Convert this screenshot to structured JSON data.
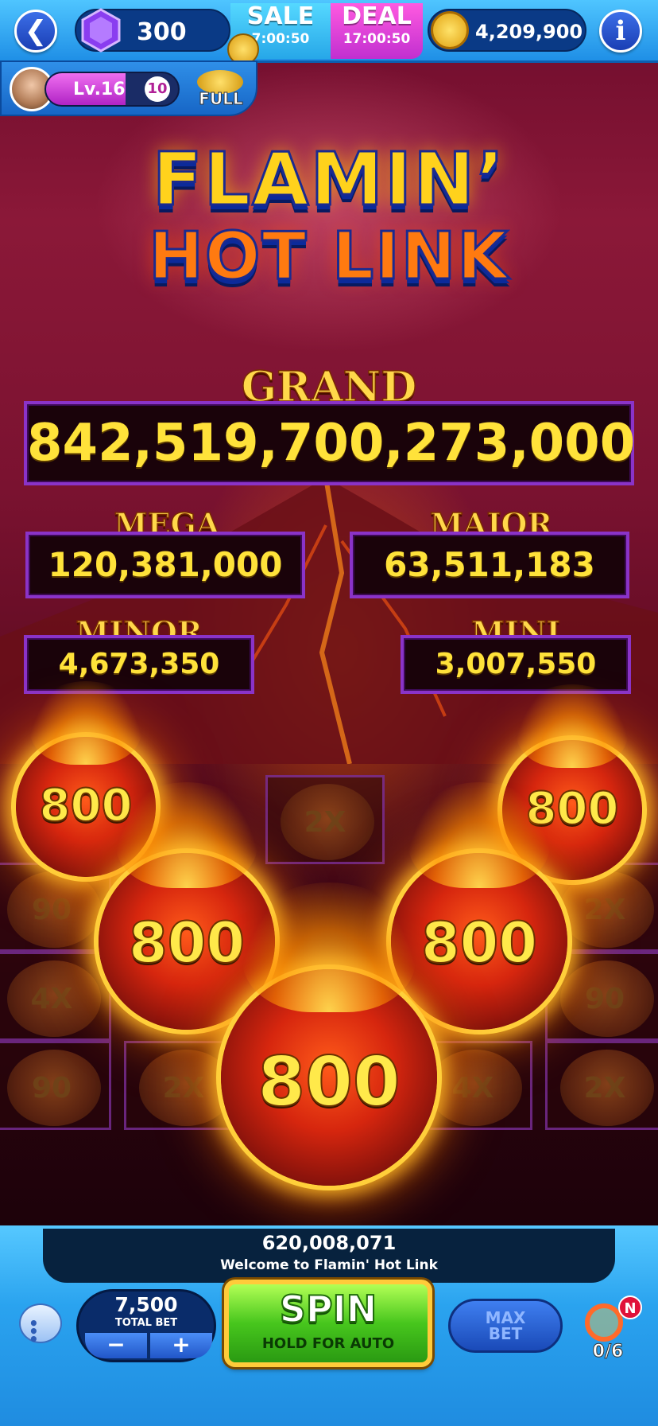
{
  "header": {
    "back_icon": "chevron-left-icon",
    "gems": "300",
    "sale": {
      "label": "SALE",
      "timer": "7:00:50"
    },
    "deal": {
      "label": "DEAL",
      "timer": "17:00:50"
    },
    "coins": "4,209,900",
    "info_icon": "info-icon"
  },
  "player": {
    "level": "Lv.16",
    "gift_count": "10",
    "piggy_status": "FULL",
    "level_progress": 0.6
  },
  "logo": {
    "line1": "FLAMIN’",
    "line2": "HOT LINK"
  },
  "jackpots": {
    "grand": {
      "label": "GRAND",
      "value": "842,519,700,273,000"
    },
    "mega": {
      "label": "MEGA",
      "value": "120,381,000"
    },
    "major": {
      "label": "MAJOR",
      "value": "63,511,183"
    },
    "minor": {
      "label": "MINOR",
      "value": "4,673,350"
    },
    "mini": {
      "label": "MINI",
      "value": "3,007,550"
    }
  },
  "reels": {
    "cells": [
      "2X",
      "90",
      "2X",
      "4X",
      "90",
      "90",
      "2X",
      "4X",
      "2X"
    ],
    "fireballs": [
      "800",
      "800",
      "800",
      "800",
      "800",
      "800"
    ]
  },
  "bottom": {
    "win_amount": "620,008,071",
    "message": "Welcome to Flamin' Hot Link",
    "total_bet": "7,500",
    "total_bet_label": "TOTAL BET",
    "minus": "−",
    "plus": "+",
    "spin": "SPIN",
    "spin_sub": "HOLD FOR AUTO",
    "max_bet_line1": "MAX",
    "max_bet_line2": "BET",
    "quest_badge": "N",
    "quest_progress": "0/6"
  },
  "colors": {
    "jackpot_text": "#ffe23a",
    "jackpot_border": "#8a33c8",
    "top_bar": "#2a9df0",
    "spin_green": "#47c61d"
  }
}
